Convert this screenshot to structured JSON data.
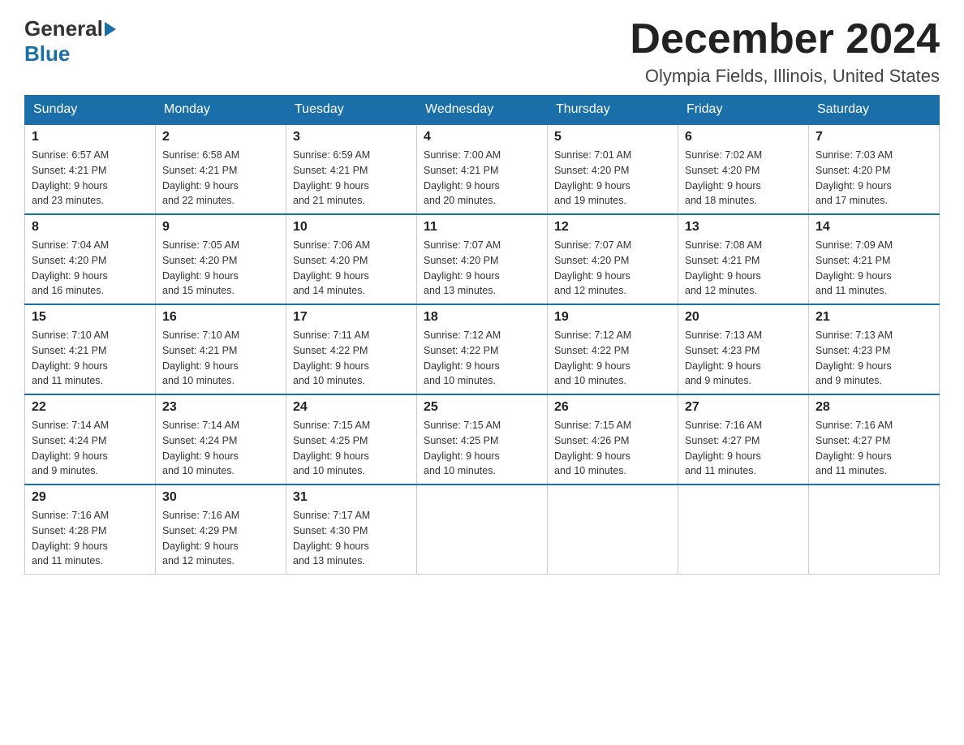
{
  "header": {
    "logo_general": "General",
    "logo_blue": "Blue",
    "month_title": "December 2024",
    "location": "Olympia Fields, Illinois, United States"
  },
  "days_of_week": [
    "Sunday",
    "Monday",
    "Tuesday",
    "Wednesday",
    "Thursday",
    "Friday",
    "Saturday"
  ],
  "weeks": [
    [
      {
        "date": "1",
        "sunrise": "6:57 AM",
        "sunset": "4:21 PM",
        "daylight": "9 hours and 23 minutes."
      },
      {
        "date": "2",
        "sunrise": "6:58 AM",
        "sunset": "4:21 PM",
        "daylight": "9 hours and 22 minutes."
      },
      {
        "date": "3",
        "sunrise": "6:59 AM",
        "sunset": "4:21 PM",
        "daylight": "9 hours and 21 minutes."
      },
      {
        "date": "4",
        "sunrise": "7:00 AM",
        "sunset": "4:21 PM",
        "daylight": "9 hours and 20 minutes."
      },
      {
        "date": "5",
        "sunrise": "7:01 AM",
        "sunset": "4:20 PM",
        "daylight": "9 hours and 19 minutes."
      },
      {
        "date": "6",
        "sunrise": "7:02 AM",
        "sunset": "4:20 PM",
        "daylight": "9 hours and 18 minutes."
      },
      {
        "date": "7",
        "sunrise": "7:03 AM",
        "sunset": "4:20 PM",
        "daylight": "9 hours and 17 minutes."
      }
    ],
    [
      {
        "date": "8",
        "sunrise": "7:04 AM",
        "sunset": "4:20 PM",
        "daylight": "9 hours and 16 minutes."
      },
      {
        "date": "9",
        "sunrise": "7:05 AM",
        "sunset": "4:20 PM",
        "daylight": "9 hours and 15 minutes."
      },
      {
        "date": "10",
        "sunrise": "7:06 AM",
        "sunset": "4:20 PM",
        "daylight": "9 hours and 14 minutes."
      },
      {
        "date": "11",
        "sunrise": "7:07 AM",
        "sunset": "4:20 PM",
        "daylight": "9 hours and 13 minutes."
      },
      {
        "date": "12",
        "sunrise": "7:07 AM",
        "sunset": "4:20 PM",
        "daylight": "9 hours and 12 minutes."
      },
      {
        "date": "13",
        "sunrise": "7:08 AM",
        "sunset": "4:21 PM",
        "daylight": "9 hours and 12 minutes."
      },
      {
        "date": "14",
        "sunrise": "7:09 AM",
        "sunset": "4:21 PM",
        "daylight": "9 hours and 11 minutes."
      }
    ],
    [
      {
        "date": "15",
        "sunrise": "7:10 AM",
        "sunset": "4:21 PM",
        "daylight": "9 hours and 11 minutes."
      },
      {
        "date": "16",
        "sunrise": "7:10 AM",
        "sunset": "4:21 PM",
        "daylight": "9 hours and 10 minutes."
      },
      {
        "date": "17",
        "sunrise": "7:11 AM",
        "sunset": "4:22 PM",
        "daylight": "9 hours and 10 minutes."
      },
      {
        "date": "18",
        "sunrise": "7:12 AM",
        "sunset": "4:22 PM",
        "daylight": "9 hours and 10 minutes."
      },
      {
        "date": "19",
        "sunrise": "7:12 AM",
        "sunset": "4:22 PM",
        "daylight": "9 hours and 10 minutes."
      },
      {
        "date": "20",
        "sunrise": "7:13 AM",
        "sunset": "4:23 PM",
        "daylight": "9 hours and 9 minutes."
      },
      {
        "date": "21",
        "sunrise": "7:13 AM",
        "sunset": "4:23 PM",
        "daylight": "9 hours and 9 minutes."
      }
    ],
    [
      {
        "date": "22",
        "sunrise": "7:14 AM",
        "sunset": "4:24 PM",
        "daylight": "9 hours and 9 minutes."
      },
      {
        "date": "23",
        "sunrise": "7:14 AM",
        "sunset": "4:24 PM",
        "daylight": "9 hours and 10 minutes."
      },
      {
        "date": "24",
        "sunrise": "7:15 AM",
        "sunset": "4:25 PM",
        "daylight": "9 hours and 10 minutes."
      },
      {
        "date": "25",
        "sunrise": "7:15 AM",
        "sunset": "4:25 PM",
        "daylight": "9 hours and 10 minutes."
      },
      {
        "date": "26",
        "sunrise": "7:15 AM",
        "sunset": "4:26 PM",
        "daylight": "9 hours and 10 minutes."
      },
      {
        "date": "27",
        "sunrise": "7:16 AM",
        "sunset": "4:27 PM",
        "daylight": "9 hours and 11 minutes."
      },
      {
        "date": "28",
        "sunrise": "7:16 AM",
        "sunset": "4:27 PM",
        "daylight": "9 hours and 11 minutes."
      }
    ],
    [
      {
        "date": "29",
        "sunrise": "7:16 AM",
        "sunset": "4:28 PM",
        "daylight": "9 hours and 11 minutes."
      },
      {
        "date": "30",
        "sunrise": "7:16 AM",
        "sunset": "4:29 PM",
        "daylight": "9 hours and 12 minutes."
      },
      {
        "date": "31",
        "sunrise": "7:17 AM",
        "sunset": "4:30 PM",
        "daylight": "9 hours and 13 minutes."
      },
      null,
      null,
      null,
      null
    ]
  ],
  "labels": {
    "sunrise": "Sunrise:",
    "sunset": "Sunset:",
    "daylight": "Daylight:"
  }
}
